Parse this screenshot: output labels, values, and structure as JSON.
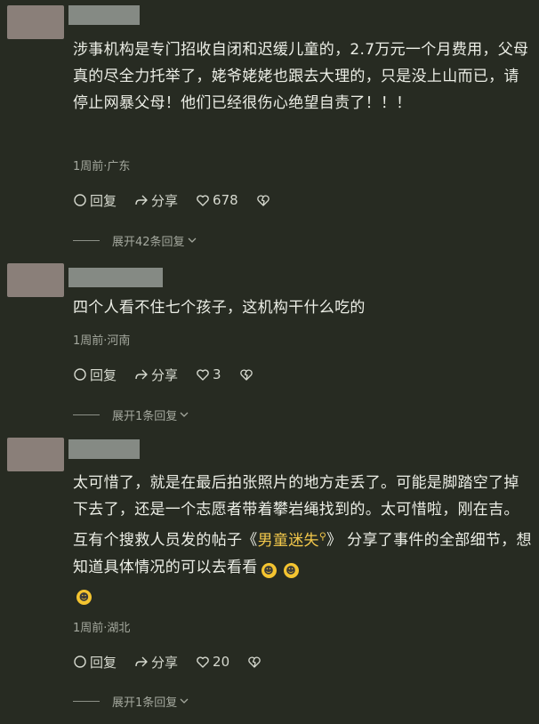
{
  "comments": [
    {
      "text": "涉事机构是专门招收自闭和迟缓儿童的，2.7万元一个月费用，父母真的尽全力托举了，姥爷姥姥也跟去大理的，只是没上山而已，请停止网暴父母！他们已经很伤心绝望自责了！！！",
      "meta": "1周前·广东",
      "reply_label": "回复",
      "share_label": "分享",
      "likes": "678",
      "expand_label": "展开42条回复"
    },
    {
      "text": "四个人看不住七个孩子，这机构干什么吃的",
      "meta": "1周前·河南",
      "reply_label": "回复",
      "share_label": "分享",
      "likes": "3",
      "expand_label": "展开1条回复"
    },
    {
      "text_before": "太可惜了，就是在最后拍张照片的地方走丢了。可能是脚踏空了掉下去了，还是一个志愿者带着攀岩绳找到的。太可惜啦，刚在吉。互有个搜救人员发的帖子《",
      "link_text": "男童迷失",
      "text_after": "》 分享了事件的全部细节，想知道具体情况的可以去看看",
      "meta": "1周前·湖北",
      "reply_label": "回复",
      "share_label": "分享",
      "likes": "20",
      "expand_label": "展开1条回复"
    }
  ],
  "colors": {
    "background": "#272b22",
    "text": "#eceee6",
    "muted": "#a4a89e",
    "highlight": "#f3c84b",
    "avatar_placeholder": "#8a7f79",
    "username_placeholder": "#858a84"
  },
  "icons": {
    "reply": "comment-bubble-icon",
    "share": "share-arrow-icon",
    "like": "heart-icon",
    "dislike": "broken-heart-icon",
    "expand": "chevron-down-icon",
    "link": "search-icon",
    "emoji": "crying-face-emoji"
  }
}
